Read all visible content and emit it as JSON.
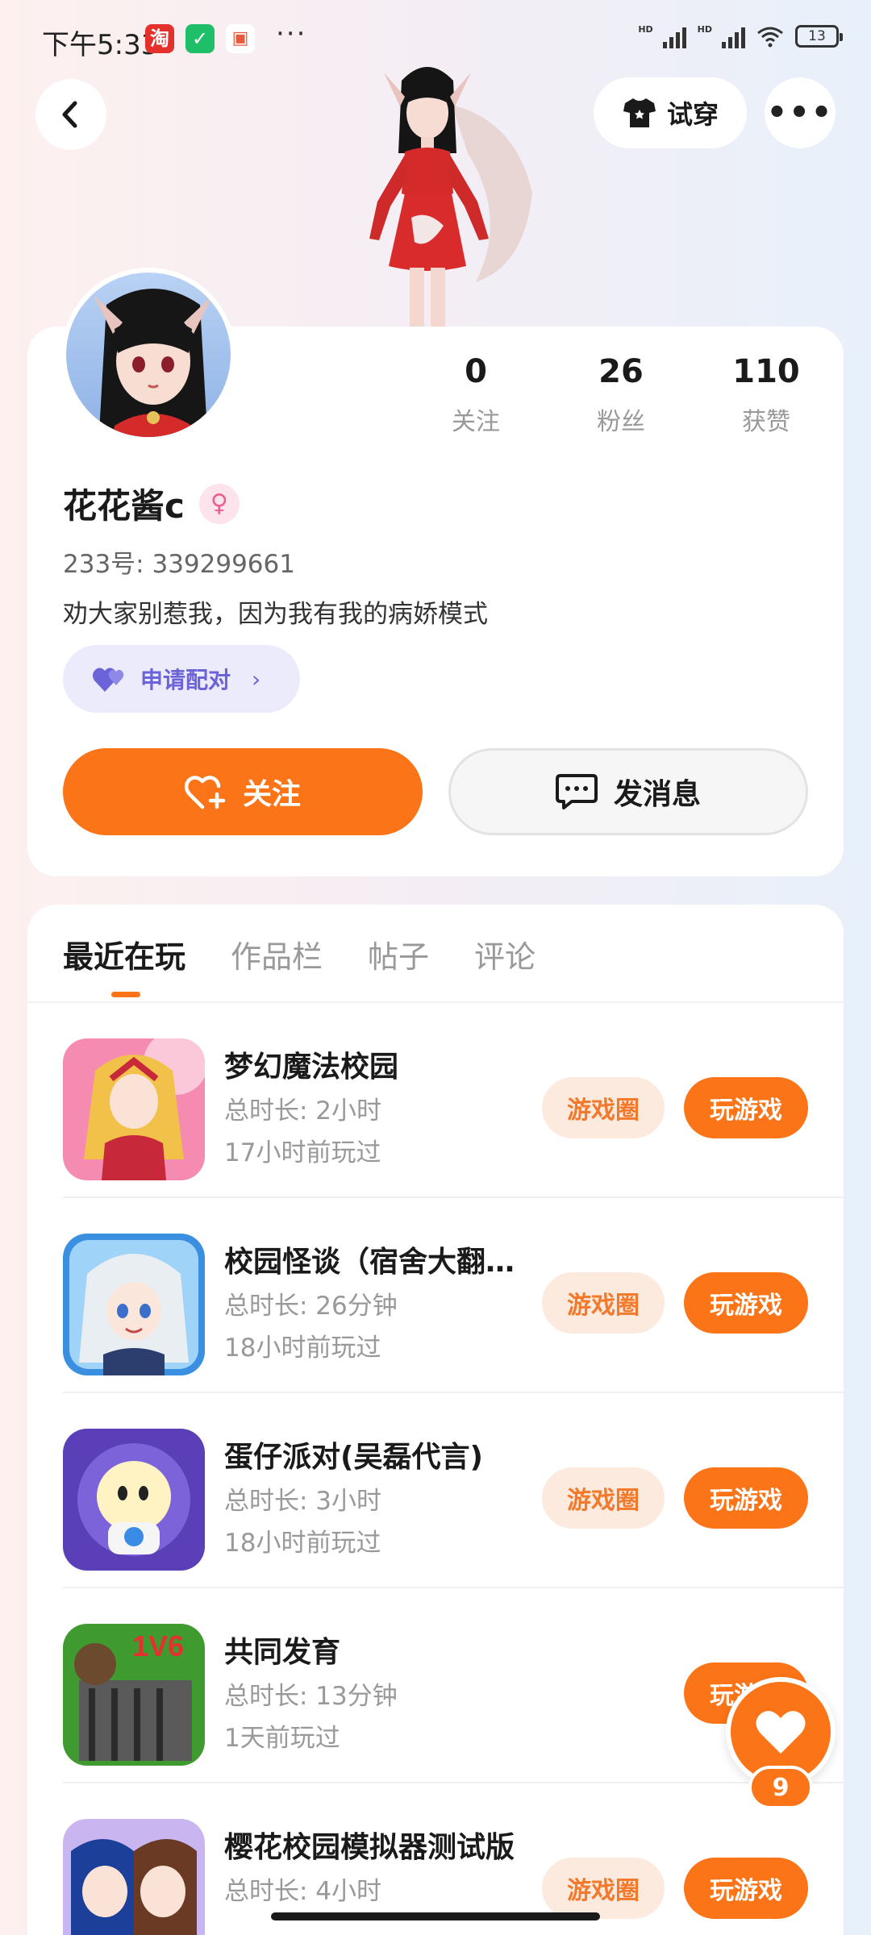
{
  "status_bar": {
    "time": "下午5:33",
    "app1_label": "淘",
    "battery": "13"
  },
  "header": {
    "try_on_label": "试穿",
    "more_label": "•••"
  },
  "profile": {
    "stats": [
      {
        "value": "0",
        "label": "关注"
      },
      {
        "value": "26",
        "label": "粉丝"
      },
      {
        "value": "110",
        "label": "获赞"
      }
    ],
    "name": "花花酱c",
    "uid": "233号: 339299661",
    "bio": "劝大家别惹我，因为我有我的病娇模式",
    "pair_label": "申请配对",
    "follow_label": "关注",
    "message_label": "发消息"
  },
  "tabs": [
    "最近在玩",
    "作品栏",
    "帖子",
    "评论"
  ],
  "games": [
    {
      "name": "梦幻魔法校园",
      "duration": "总时长: 2小时",
      "last_played": "17小时前玩过",
      "circle_label": "游戏圈",
      "play_label": "玩游戏"
    },
    {
      "name": "校园怪谈（宿舍大翻…",
      "duration": "总时长: 26分钟",
      "last_played": "18小时前玩过",
      "circle_label": "游戏圈",
      "play_label": "玩游戏"
    },
    {
      "name": "蛋仔派对(吴磊代言)",
      "duration": "总时长: 3小时",
      "last_played": "18小时前玩过",
      "circle_label": "游戏圈",
      "play_label": "玩游戏"
    },
    {
      "name": "共同发育",
      "duration": "总时长: 13分钟",
      "last_played": "1天前玩过",
      "icon_text": "1V6",
      "circle_label": "",
      "play_label": "玩游戏"
    },
    {
      "name": "樱花校园模拟器测试版",
      "duration": "总时长: 4小时",
      "last_played": "",
      "circle_label": "游戏圈",
      "play_label": "玩游戏"
    }
  ],
  "like_fab": {
    "count": "9"
  },
  "colors": {
    "accent": "#fb7417",
    "pair": "#6c63d8",
    "circle_bg": "#fdeade"
  }
}
